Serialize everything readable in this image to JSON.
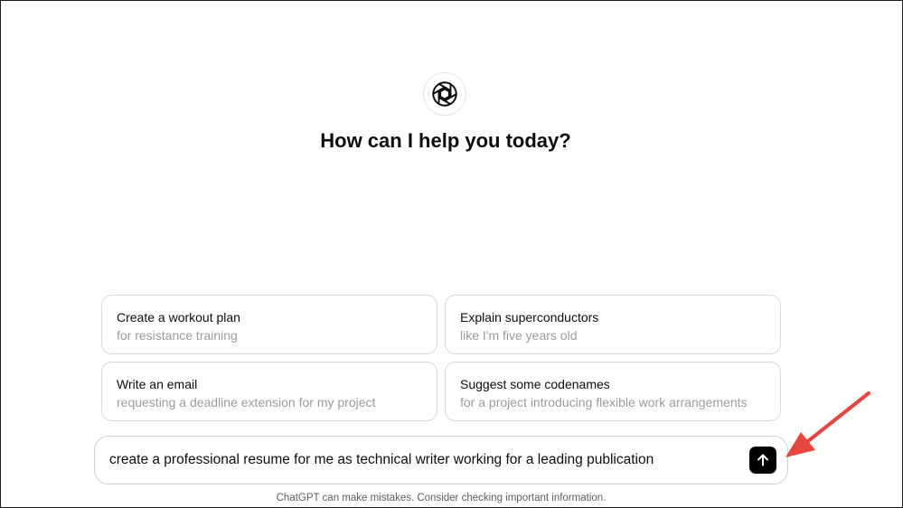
{
  "header": {
    "logo_icon": "openai-logo-icon",
    "title": "How can I help you today?"
  },
  "suggestions": [
    {
      "title": "Create a workout plan",
      "subtitle": "for resistance training"
    },
    {
      "title": "Explain superconductors",
      "subtitle": "like I'm five years old"
    },
    {
      "title": "Write an email",
      "subtitle": "requesting a deadline extension for my project"
    },
    {
      "title": "Suggest some codenames",
      "subtitle": "for a project introducing flexible work arrangements"
    }
  ],
  "composer": {
    "value": "create a professional resume for me as technical writer working for a leading publication",
    "send_icon": "arrow-up-icon"
  },
  "footer": {
    "disclaimer": "ChatGPT can make mistakes. Consider checking important information."
  },
  "colors": {
    "annotation_arrow": "#e8453c",
    "send_button": "#000000",
    "card_border": "#d9d9d9",
    "muted_text": "#9b9b9b"
  }
}
